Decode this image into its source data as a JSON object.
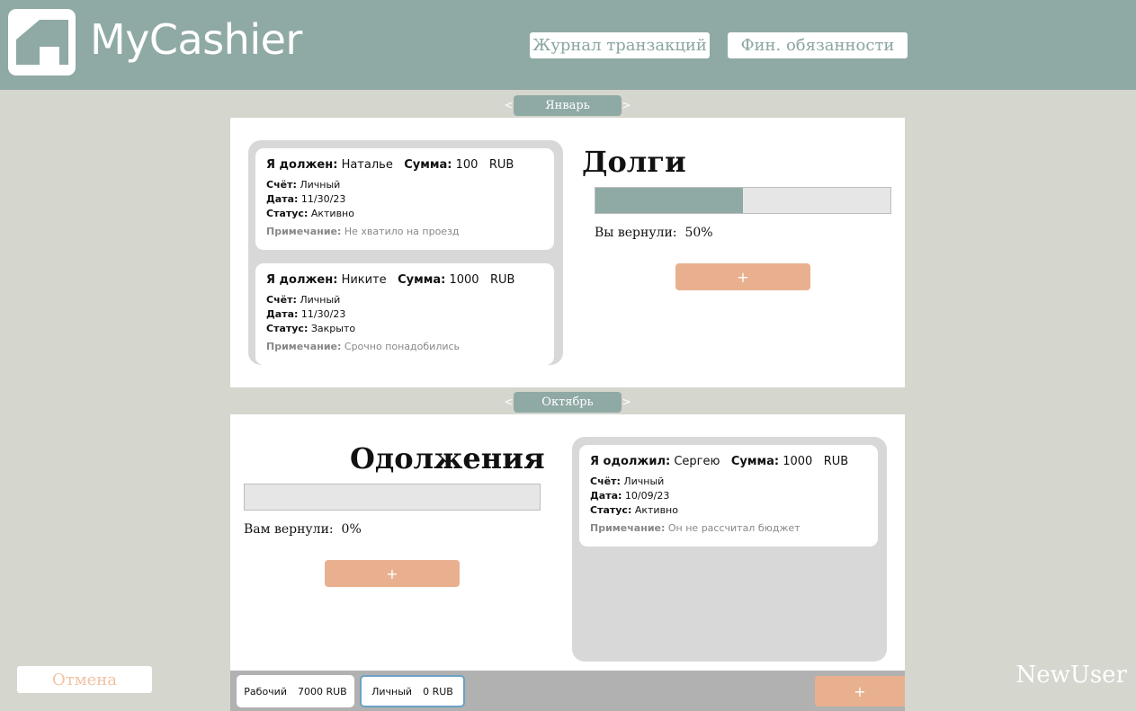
{
  "header": {
    "app_title": "MyCashier",
    "nav": [
      "Журнал транзакций",
      "Фин. обязанности"
    ]
  },
  "debts": {
    "month": "Январь",
    "title": "Долги",
    "progress_label": "Вы вернули:",
    "progress_value": "50%",
    "progress_fraction": 0.5,
    "add_label": "+",
    "cards": [
      {
        "head_label": "Я должен:",
        "person": "Наталье",
        "sum_label": "Сумма:",
        "amount": "100",
        "currency": "RUB",
        "account_label": "Счёт:",
        "account": "Личный",
        "date_label": "Дата:",
        "date": "11/30/23",
        "status_label": "Статус:",
        "status": "Активно",
        "note_label": "Примечание:",
        "note": "Не хватило на проезд"
      },
      {
        "head_label": "Я должен:",
        "person": "Никите",
        "sum_label": "Сумма:",
        "amount": "1000",
        "currency": "RUB",
        "account_label": "Счёт:",
        "account": "Личный",
        "date_label": "Дата:",
        "date": "11/30/23",
        "status_label": "Статус:",
        "status": "Закрыто",
        "note_label": "Примечание:",
        "note": "Срочно понадобились"
      }
    ]
  },
  "loans": {
    "month": "Октябрь",
    "title": "Одолжения",
    "progress_label": "Вам вернули:",
    "progress_value": "0%",
    "progress_fraction": 0,
    "add_label": "+",
    "cards": [
      {
        "head_label": "Я одолжил:",
        "person": "Сергею",
        "sum_label": "Сумма:",
        "amount": "1000",
        "currency": "RUB",
        "account_label": "Счёт:",
        "account": "Личный",
        "date_label": "Дата:",
        "date": "10/09/23",
        "status_label": "Статус:",
        "status": "Активно",
        "note_label": "Примечание:",
        "note": "Он не рассчитал бюджет"
      }
    ]
  },
  "arrows": {
    "prev": "<",
    "next": ">"
  },
  "accounts": [
    {
      "name": "Рабочий",
      "balance": "7000 RUB",
      "selected": false
    },
    {
      "name": "Личный",
      "balance": "0 RUB",
      "selected": true
    }
  ],
  "bottom_add_label": "+",
  "cancel_label": "Отмена",
  "username": "NewUser",
  "colors": {
    "header_bg": "#8fa9a5",
    "page_bg": "#d5d6cd",
    "accent_peach": "#e8b08f",
    "progress_fill": "#8fa9a5",
    "selected_account_border": "#6aa2c4"
  }
}
